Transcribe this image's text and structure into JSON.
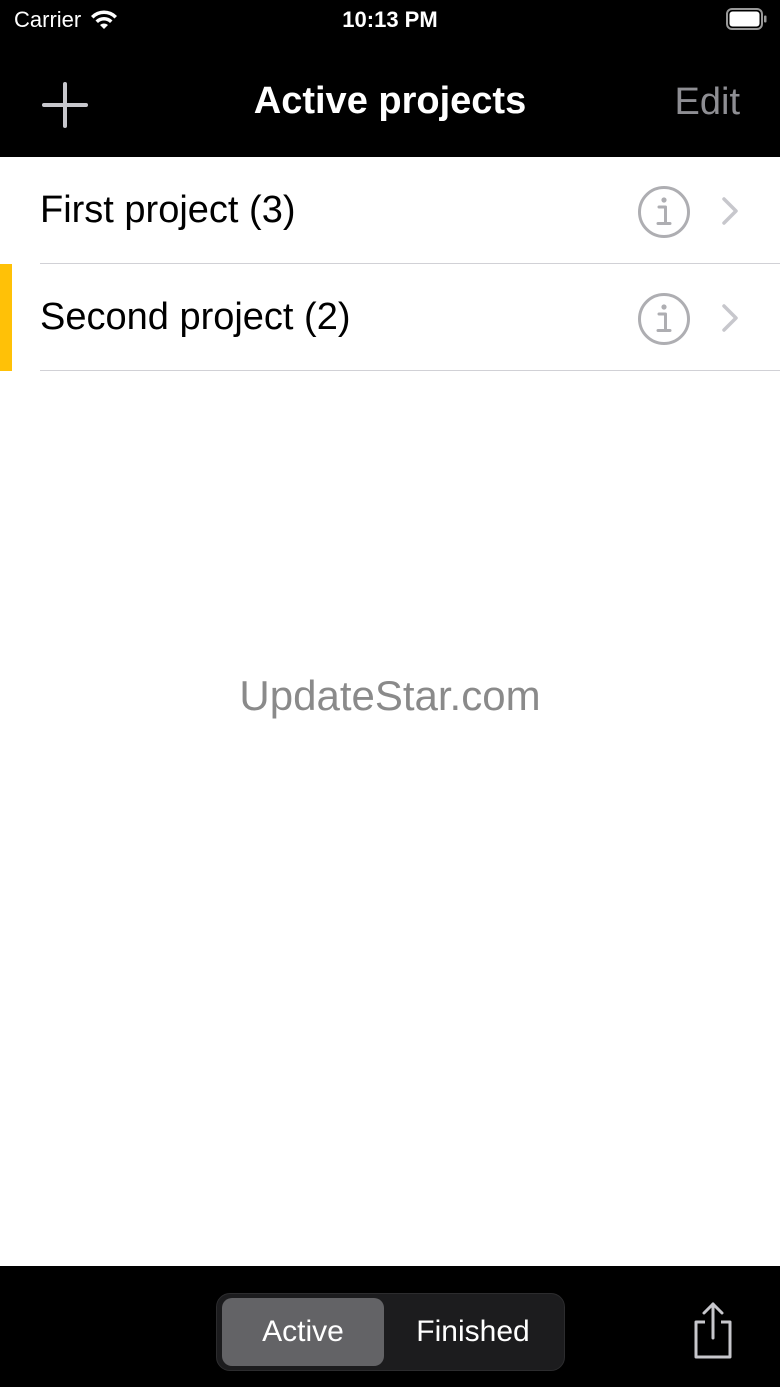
{
  "status_bar": {
    "carrier": "Carrier",
    "time": "10:13 PM",
    "wifi_icon": "wifi-icon",
    "battery_icon": "battery-full-icon"
  },
  "nav": {
    "add_icon": "plus-icon",
    "title": "Active projects",
    "edit_label": "Edit"
  },
  "projects": [
    {
      "label": "First project (3)",
      "info_icon": "info-circle-icon",
      "chevron_icon": "chevron-right-icon",
      "highlighted": false
    },
    {
      "label": "Second project (2)",
      "info_icon": "info-circle-icon",
      "chevron_icon": "chevron-right-icon",
      "highlighted": true
    }
  ],
  "watermark": "UpdateStar.com",
  "toolbar": {
    "segments": [
      {
        "label": "Active",
        "selected": true
      },
      {
        "label": "Finished",
        "selected": false
      }
    ],
    "share_icon": "share-icon"
  },
  "colors": {
    "bar_background": "#000000",
    "highlight_marker": "#ffc107",
    "edit_text": "#8e8e93",
    "segment_selected": "#636366"
  }
}
